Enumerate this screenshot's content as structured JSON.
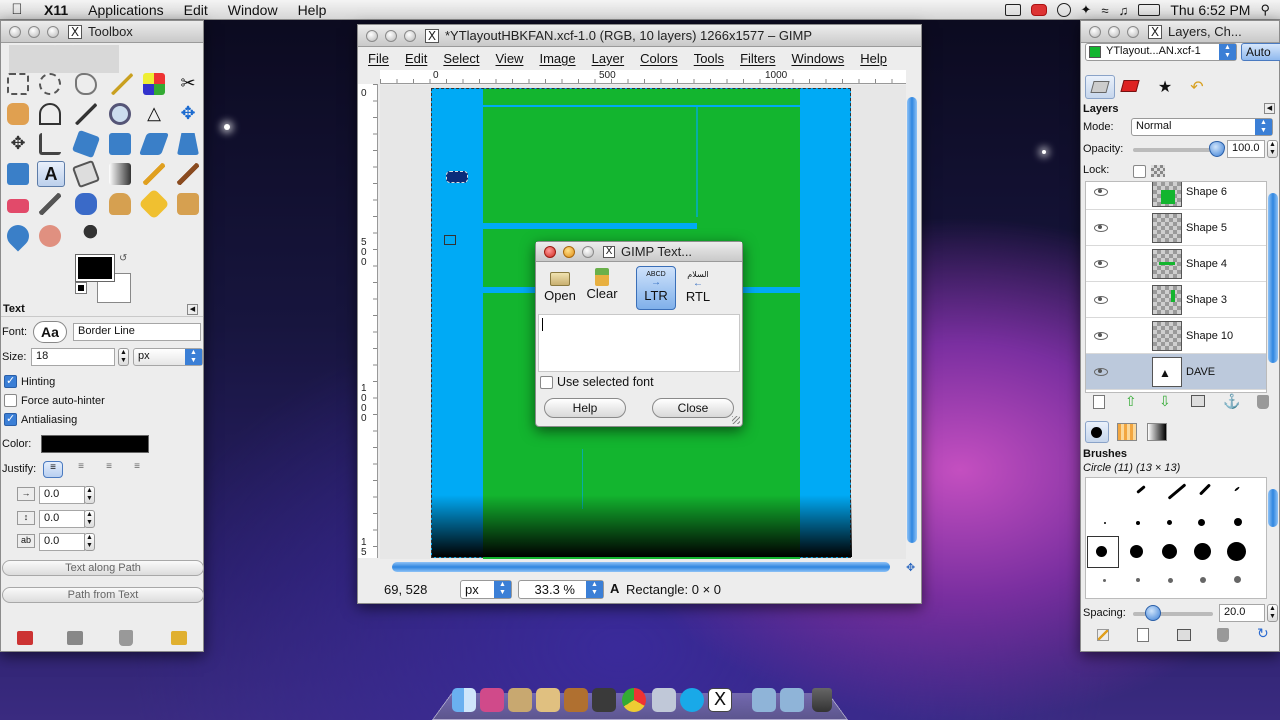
{
  "menubar": {
    "app": "X11",
    "items": [
      "Applications",
      "Edit",
      "Window",
      "Help"
    ],
    "clock": "Thu 6:52 PM"
  },
  "toolbox": {
    "title": "Toolbox",
    "text_options": {
      "section_title": "Text",
      "font_label": "Font:",
      "font_value": "Border Line",
      "size_label": "Size:",
      "size_value": "18",
      "size_unit": "px",
      "hinting": "Hinting",
      "force_autohinter": "Force auto-hinter",
      "antialiasing": "Antialiasing",
      "color_label": "Color:",
      "justify_label": "Justify:",
      "indent": "0.0",
      "line_spacing": "0.0",
      "letter_spacing": "0.0",
      "text_along_path": "Text along Path",
      "path_from_text": "Path from Text"
    }
  },
  "image_window": {
    "title": "*YTlayoutHBKFAN.xcf-1.0 (RGB, 10 layers) 1266x1577 – GIMP",
    "menu": [
      "File",
      "Edit",
      "Select",
      "View",
      "Image",
      "Layer",
      "Colors",
      "Tools",
      "Filters",
      "Windows",
      "Help"
    ],
    "ruler_h": [
      "0",
      "500",
      "1000"
    ],
    "ruler_v": [
      "0",
      "500",
      "1000",
      "15"
    ],
    "status": {
      "coords": "69, 528",
      "unit": "px",
      "zoom": "33.3 %",
      "tool_info": "Rectangle: 0 × 0"
    }
  },
  "text_dialog": {
    "title": "GIMP Text...",
    "buttons": {
      "open": "Open",
      "clear": "Clear",
      "ltr": "LTR",
      "rtl": "RTL",
      "help": "Help",
      "close": "Close"
    },
    "ltr_glyph": "ABCD",
    "rtl_glyph": "السلام",
    "use_selected_font": "Use selected font",
    "text_value": ""
  },
  "layers_window": {
    "title": "Layers, Ch...",
    "image_select": "YTlayout...AN.xcf-1",
    "auto": "Auto",
    "panel_title": "Layers",
    "mode_label": "Mode:",
    "mode_value": "Normal",
    "opacity_label": "Opacity:",
    "opacity_value": "100.0",
    "lock_label": "Lock:",
    "layers": [
      {
        "name": "Shape 6"
      },
      {
        "name": "Shape 5"
      },
      {
        "name": "Shape 4"
      },
      {
        "name": "Shape 3"
      },
      {
        "name": "Shape 10"
      },
      {
        "name": "DAVE",
        "selected": true
      }
    ],
    "brushes": {
      "title": "Brushes",
      "current": "Circle (11) (13 × 13)",
      "spacing_label": "Spacing:",
      "spacing_value": "20.0"
    }
  },
  "colors": {
    "canvas_blue": "#00aaf5",
    "canvas_green": "#13b52f",
    "fg_color": "#000000",
    "selection": "#3b7fd6"
  }
}
